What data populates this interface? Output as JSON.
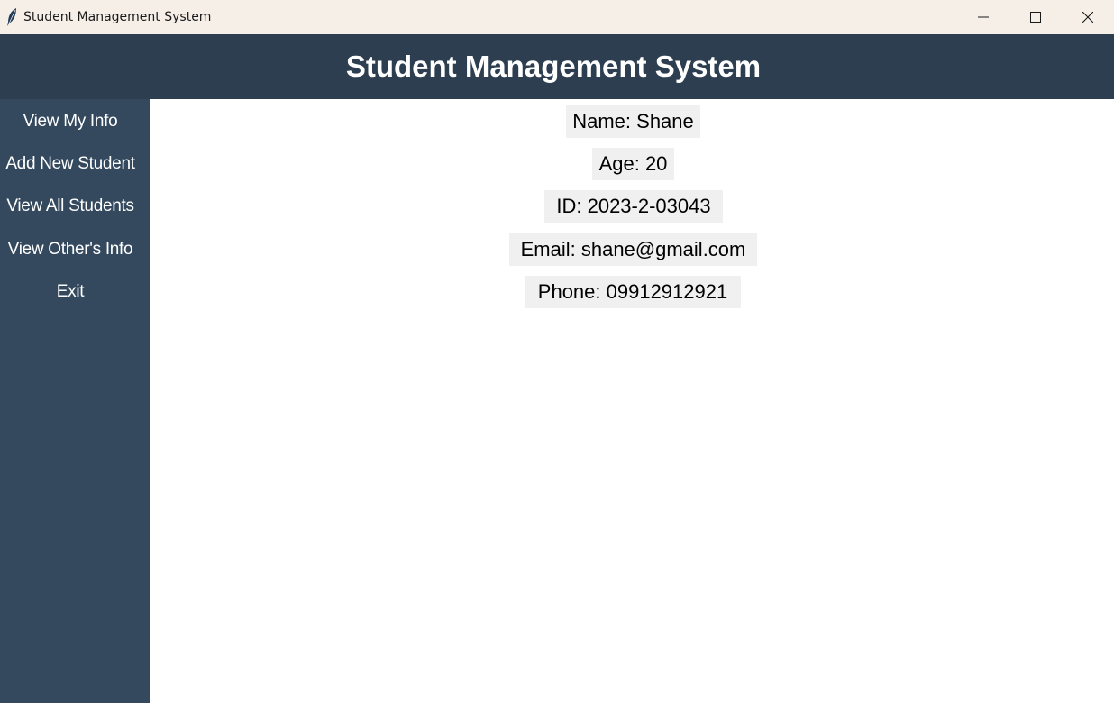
{
  "window": {
    "title": "Student Management System",
    "icon": "feather-icon"
  },
  "header": {
    "title": "Student Management System"
  },
  "sidebar": {
    "items": [
      {
        "label": "View My Info"
      },
      {
        "label": "Add New Student"
      },
      {
        "label": "View All Students"
      },
      {
        "label": "View Other's Info"
      },
      {
        "label": "Exit"
      }
    ]
  },
  "student_info": {
    "name": "Name: Shane",
    "age": "Age: 20",
    "id": "ID: 2023-2-03043",
    "email": "Email: shane@gmail.com",
    "phone": "Phone: 09912912921"
  },
  "colors": {
    "header_bg": "#2c3e50",
    "sidebar_bg": "#34495e",
    "label_bg": "#f0f0f0",
    "titlebar_bg": "#f5efe7"
  }
}
